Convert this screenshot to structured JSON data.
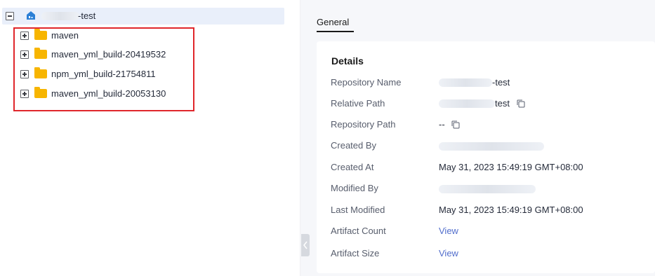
{
  "tree": {
    "root": {
      "suffix": "-test"
    },
    "children": [
      {
        "label": "maven"
      },
      {
        "label": "maven_yml_build-20419532"
      },
      {
        "label": "npm_yml_build-21754811"
      },
      {
        "label": "maven_yml_build-20053130"
      }
    ]
  },
  "tabs": [
    {
      "label": "General",
      "active": true
    }
  ],
  "details": {
    "title": "Details",
    "rows": [
      {
        "label": "Repository Name",
        "value": "-test"
      },
      {
        "label": "Relative Path",
        "value": "test"
      },
      {
        "label": "Repository Path",
        "value": "--"
      },
      {
        "label": "Created By",
        "value": ""
      },
      {
        "label": "Created At",
        "value": "May 31, 2023 15:49:19 GMT+08:00"
      },
      {
        "label": "Modified By",
        "value": ""
      },
      {
        "label": "Last Modified",
        "value": "May 31, 2023 15:49:19 GMT+08:00"
      },
      {
        "label": "Artifact Count",
        "value": "View"
      },
      {
        "label": "Artifact Size",
        "value": "View"
      }
    ]
  },
  "colors": {
    "accent_link": "#526ecc",
    "highlight_box": "#e0262b",
    "folder": "#f7b500",
    "repo_icon": "#2b7fd6"
  },
  "icons": {
    "collapse": "minus-square-icon",
    "expand": "plus-square-icon",
    "folder": "folder-icon",
    "repository": "repository-icon",
    "copy": "copy-icon",
    "panel_toggle": "chevron-left-icon"
  }
}
